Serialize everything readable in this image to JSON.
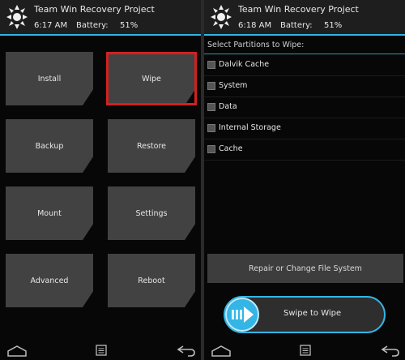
{
  "left_screen": {
    "header": {
      "title": "Team Win Recovery Project",
      "time": "6:17 AM",
      "battery_label": "Battery:",
      "battery_value": "51%"
    },
    "tiles": [
      {
        "label": "Install"
      },
      {
        "label": "Wipe",
        "highlighted": true
      },
      {
        "label": "Backup"
      },
      {
        "label": "Restore"
      },
      {
        "label": "Mount"
      },
      {
        "label": "Settings"
      },
      {
        "label": "Advanced"
      },
      {
        "label": "Reboot"
      }
    ],
    "nav": {
      "icons": [
        "home-icon",
        "menu-icon",
        "back-icon"
      ]
    }
  },
  "right_screen": {
    "header": {
      "title": "Team Win Recovery Project",
      "time": "6:18 AM",
      "battery_label": "Battery:",
      "battery_value": "51%"
    },
    "section_title": "Select Partitions to Wipe:",
    "options": [
      {
        "label": "Dalvik Cache",
        "checked": false
      },
      {
        "label": "System",
        "checked": false
      },
      {
        "label": "Data",
        "checked": false
      },
      {
        "label": "Internal Storage",
        "checked": false
      },
      {
        "label": "Cache",
        "checked": false
      }
    ],
    "repair_button": "Repair or Change File System",
    "swipe": {
      "label": "Swipe to Wipe"
    },
    "nav": {
      "icons": [
        "home-icon",
        "menu-icon",
        "back-icon"
      ]
    }
  },
  "colors": {
    "accent": "#33b5e5",
    "highlight": "#d42020",
    "tile": "#424242",
    "header": "#1e1e1e"
  }
}
